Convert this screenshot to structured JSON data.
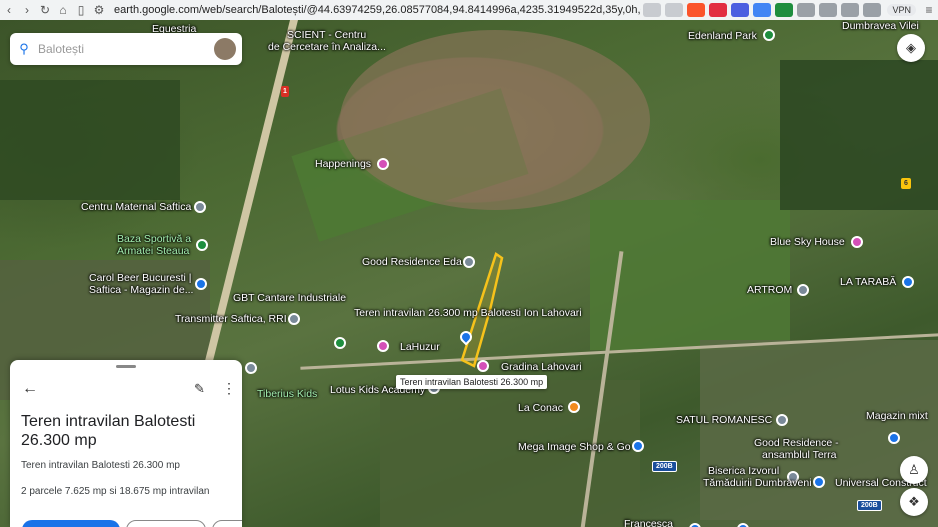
{
  "browser": {
    "url": "earth.google.com/web/search/Balotești/@44.63974259,26.08577084,94.8414996a,4235.31949522d,35y,0h,0t,0...",
    "vpn_label": "VPN"
  },
  "search": {
    "placeholder": "Balotești"
  },
  "map_labels": {
    "equestria": "Equestria",
    "scient": "SCIENT - Centru",
    "scient2": "de Cercetare în Analiza...",
    "edenland": "Edenland Park",
    "dumbravea": "Dumbravea Vilei",
    "happenings": "Happenings",
    "centru_maternal": "Centru Maternal Saftica",
    "baza_sportiva1": "Baza Sportivă a",
    "baza_sportiva2": "Armatei Steaua",
    "good_residence": "Good Residence Eda",
    "blue_sky": "Blue Sky House",
    "carol_beer1": "Carol Beer Bucuresti |",
    "carol_beer2": "Saftica - Magazin de...",
    "gbt": "GBT Cantare Industriale",
    "artrom": "ARTROM",
    "la_taraba": "LA TARABĂ",
    "transmitter": "Transmitter Saftica, RRI",
    "teren_main": "Teren intravilan  26.300 mp Balotesti Ion Lahovari",
    "lahuzur": "LaHuzur",
    "gradina": "Gradina Lahovari",
    "tiberius": "Tiberius Kids",
    "lotus": "Lotus Kids Academy",
    "la_conac": "La Conac",
    "satul": "SATUL ROMANESC",
    "magazin": "Magazin mixt",
    "good_res2": "Good Residence -",
    "good_res3": "ansamblul Terra",
    "mega_image": "Mega Image Shop & Go",
    "universal": "Universal Construct",
    "biserica1": "Biserica Izvorul",
    "biserica2": "Tămăduirii Dumbraveni",
    "francesca": "Francesca",
    "tooltip": "Teren intravilan Balotesti 26.300 mp"
  },
  "road_signs": {
    "r1": "1",
    "r6": "6",
    "r200b_a": "200B",
    "r200b_b": "200B"
  },
  "panel": {
    "title": "Teren intravilan Balotesti 26.300 mp",
    "description": "Teren intravilan Balotesti 26.300 mp",
    "details": "2 parcele 7.625 mp si 18.675 mp intravilan"
  },
  "colors": {
    "accent": "#1a73e8",
    "parcel_outline": "#f6c21b",
    "poi_pink": "#d44fb8",
    "poi_green": "#1e8e3e"
  },
  "icons": {
    "search": "search-icon",
    "layers": "layers-icon",
    "pegman": "pegman-icon",
    "compass": "compass-icon",
    "back": "back-arrow-icon",
    "edit": "pencil-icon",
    "more": "more-vert-icon"
  }
}
